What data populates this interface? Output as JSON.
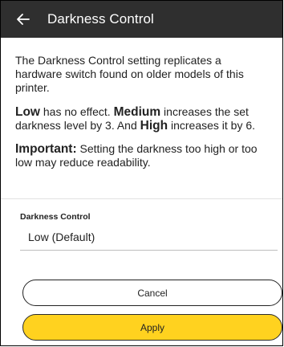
{
  "header": {
    "title": "Darkness Control",
    "back_icon": "arrow-left-icon"
  },
  "content": {
    "intro": "The Darkness Control setting replicates a hardware switch found on older models of this printer.",
    "levels": {
      "low_label": "Low",
      "low_text": " has no effect. ",
      "medium_label": "Medium",
      "medium_text": " increases the set darkness level by 3. And ",
      "high_label": "High",
      "high_text": " increases it by 6."
    },
    "important": {
      "label": "Important:",
      "text": " Setting the darkness too high or too low may reduce readability."
    }
  },
  "field": {
    "label": "Darkness Control",
    "value": "Low (Default)"
  },
  "buttons": {
    "cancel": "Cancel",
    "apply": "Apply"
  },
  "colors": {
    "topbar": "#2f2f2f",
    "apply": "#ffd21f"
  }
}
